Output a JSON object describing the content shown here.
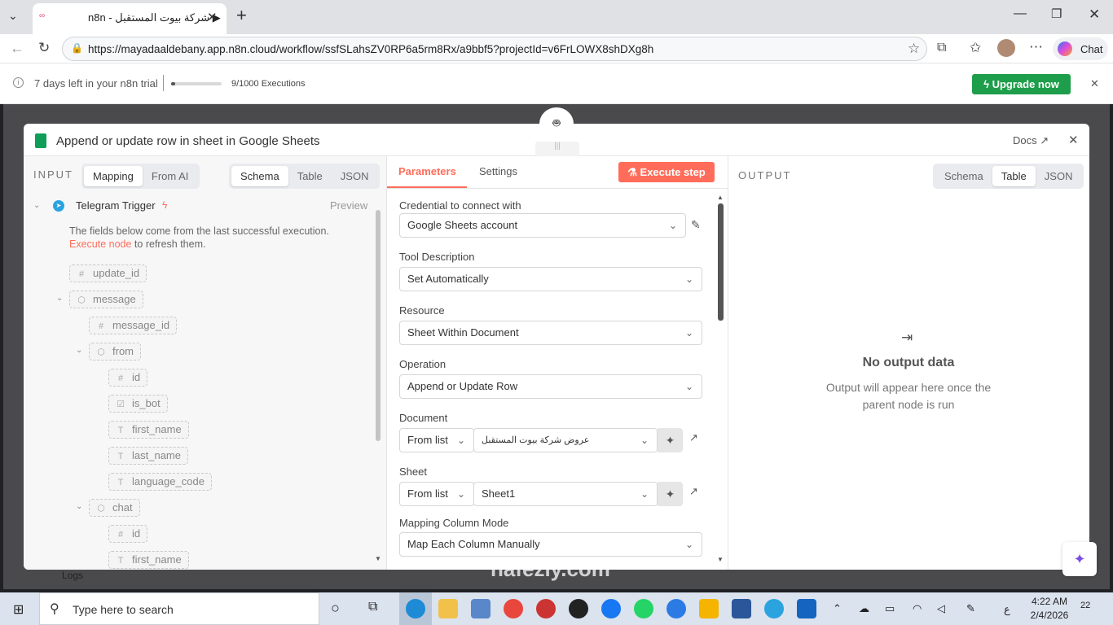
{
  "browser": {
    "tab_title": "n8n - شركة بيوت المستقبل ▶",
    "url": "https://mayadaaldebany.app.n8n.cloud/workflow/ssfSLahsZV0RP6a5rm8Rx/a9bbf5?projectId=v6FrLOWX8shDXg8h",
    "chat_label": "Chat"
  },
  "trial": {
    "days_left": "7 days left in your n8n trial",
    "executions": "9/1000 Executions",
    "executions_progress": 0.009,
    "upgrade": "Upgrade now"
  },
  "node": {
    "title": "Append or update row in sheet in Google Sheets",
    "docs": "Docs"
  },
  "input": {
    "heading": "INPUT",
    "mode_tabs": [
      "Mapping",
      "From AI"
    ],
    "view_tabs": [
      "Schema",
      "Table",
      "JSON"
    ],
    "trigger": "Telegram Trigger",
    "preview": "Preview",
    "note": "The fields below come from the last successful execution.",
    "execute_link": "Execute node",
    "note_tail": " to refresh them.",
    "fields": {
      "update_id": "update_id",
      "message": "message",
      "message_id": "message_id",
      "from": "from",
      "id": "id",
      "is_bot": "is_bot",
      "first_name": "first_name",
      "last_name": "last_name",
      "language_code": "language_code",
      "chat": "chat",
      "chat_id": "id",
      "chat_first_name": "first_name"
    }
  },
  "params": {
    "tabs": [
      "Parameters",
      "Settings"
    ],
    "execute": "Execute step",
    "credential_label": "Credential to connect with",
    "credential_value": "Google Sheets account",
    "tool_desc_label": "Tool Description",
    "tool_desc_value": "Set Automatically",
    "resource_label": "Resource",
    "resource_value": "Sheet Within Document",
    "operation_label": "Operation",
    "operation_value": "Append or Update Row",
    "document_label": "Document",
    "document_mode": "From list",
    "document_value": "عروض شركة بيوت المستقبل",
    "sheet_label": "Sheet",
    "sheet_mode": "From list",
    "sheet_value": "Sheet1",
    "mapping_label": "Mapping Column Mode",
    "mapping_value": "Map Each Column Manually"
  },
  "output": {
    "heading": "OUTPUT",
    "view_tabs": [
      "Schema",
      "Table",
      "JSON"
    ],
    "empty_title": "No output data",
    "empty_desc": "Output will appear here once the parent node is run"
  },
  "background": {
    "logs": "Logs"
  },
  "taskbar": {
    "search": "Type here to search",
    "time": "4:22 AM",
    "date": "2/4/2026",
    "lang": "ع",
    "notif": "22",
    "watermark": "nafezly.com"
  },
  "colors": {
    "accent": "#ff6d5a",
    "upgrade": "#1e9e4a",
    "tab_active": "#ff6d5a"
  }
}
